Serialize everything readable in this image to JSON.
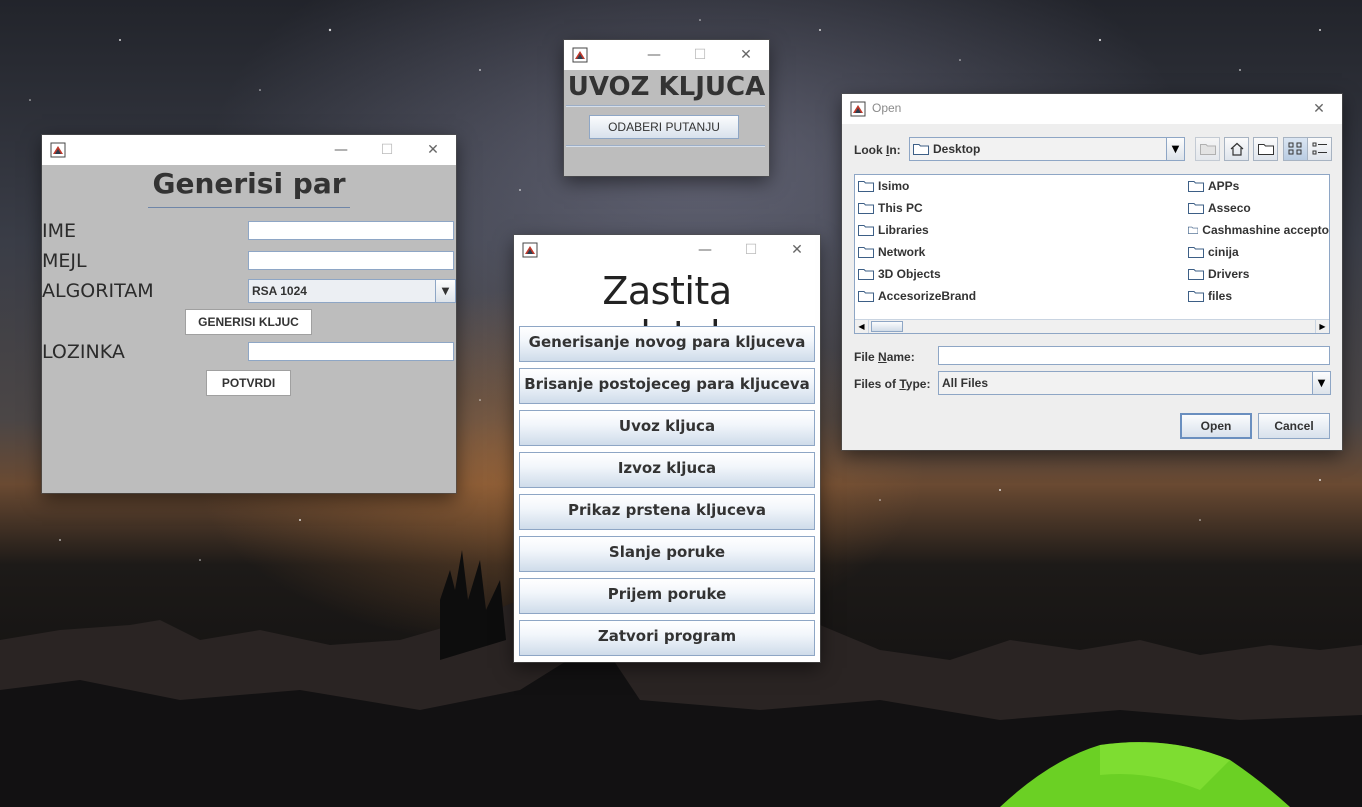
{
  "generisi_window": {
    "title": "Generisi par",
    "fields": [
      {
        "label": "IME",
        "value": ""
      },
      {
        "label": "MEJL",
        "value": ""
      },
      {
        "label": "ALGORITAM",
        "value": "RSA 1024"
      },
      {
        "label": "LOZINKA",
        "value": ""
      }
    ],
    "generate_button": "GENERISI KLJUC",
    "confirm_button": "POTVRDI"
  },
  "uvoz_window": {
    "title": "UVOZ KLJUCA",
    "choose_path_button": "ODABERI PUTANJU"
  },
  "main_window": {
    "title": "Zastita podataka",
    "buttons": [
      "Generisanje novog para kljuceva",
      "Brisanje postojeceg para kljuceva",
      "Uvoz kljuca",
      "Izvoz kljuca",
      "Prikaz prstena kljuceva",
      "Slanje poruke",
      "Prijem poruke",
      "Zatvori program"
    ]
  },
  "open_dialog": {
    "title": "Open",
    "look_in_label_pre": "Look ",
    "look_in_label_u": "I",
    "look_in_label_post": "n:",
    "look_in_value": "Desktop",
    "files_col1": [
      "Isimo",
      "This PC",
      "Libraries",
      "Network",
      "3D Objects",
      "AccesorizeBrand"
    ],
    "files_col2": [
      "APPs",
      "Asseco",
      "Cashmashine accepto",
      "cinija",
      "Drivers",
      "files"
    ],
    "file_name_label_pre": "File ",
    "file_name_label_u": "N",
    "file_name_label_post": "ame:",
    "file_name_value": "",
    "files_type_label_pre": "Files of ",
    "files_type_label_u": "T",
    "files_type_label_post": "ype:",
    "files_type_value": "All Files",
    "open_button": "Open",
    "cancel_button": "Cancel"
  },
  "colors": {
    "panel_gray": "#bdbdbd",
    "button_border": "#8ea6c5",
    "dialog_bg": "#eeeeee"
  }
}
